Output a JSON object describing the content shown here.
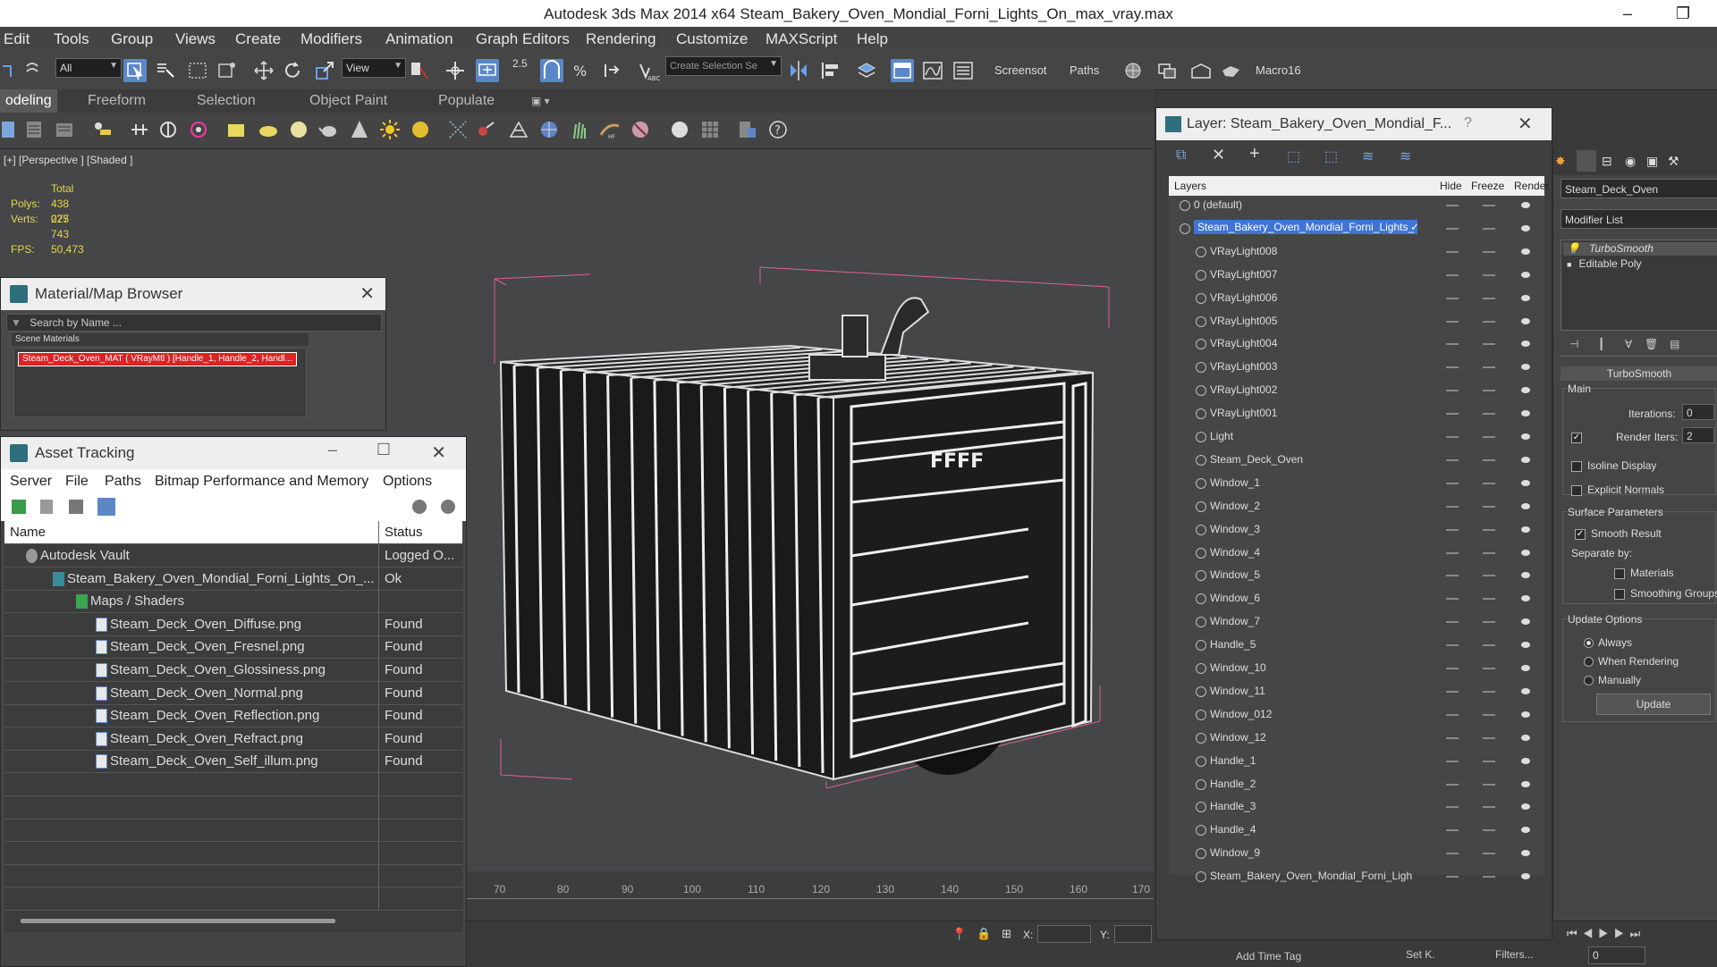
{
  "titlebar": {
    "text": "Autodesk 3ds Max  2014 x64     Steam_Bakery_Oven_Mondial_Forni_Lights_On_max_vray.max",
    "minimize": "–",
    "restore": "❐"
  },
  "menu": [
    "Edit",
    "Tools",
    "Group",
    "Views",
    "Create",
    "Modifiers",
    "Animation",
    "Graph Editors",
    "Rendering",
    "Customize",
    "MAXScript",
    "Help"
  ],
  "toolbar": {
    "filter_value": "All",
    "refcoord_value": "View",
    "snap_label": "2.5",
    "selection_set_placeholder": "Create Selection Se",
    "screenshot_label": "Screensot",
    "paths_label": "Paths",
    "macro_label": "Macro16"
  },
  "ribbon_tabs": [
    "odeling",
    "Freeform",
    "Selection",
    "Object Paint",
    "Populate"
  ],
  "viewport": {
    "label": "[+] [Perspective ] [Shaded ]",
    "stats": {
      "total_label": "Total",
      "polys_label": "Polys:",
      "polys_value": "438 075",
      "verts_label": "Verts:",
      "verts_value": "227 743",
      "fps_label": "FPS:",
      "fps_value": "50,473"
    }
  },
  "timeline": {
    "ticks": [
      "70",
      "80",
      "90",
      "100",
      "110",
      "120",
      "130",
      "140",
      "150",
      "160",
      "170"
    ]
  },
  "statusbar": {
    "x_label": "X:",
    "y_label": "Y:",
    "add_time_tag": "Add Time Tag",
    "setk": "Set K.",
    "filters": "Filters...",
    "frame_value": "0"
  },
  "material_browser": {
    "title": "Material/Map Browser",
    "search_placeholder": "Search by Name ...",
    "section": "Scene Materials",
    "item": "Steam_Deck_Oven_MAT ( VRayMtl ) [Handle_1, Handle_2, Handl..."
  },
  "asset_tracking": {
    "title": "Asset Tracking",
    "menu": [
      "Server",
      "File",
      "Paths",
      "Bitmap Performance and Memory",
      "Options"
    ],
    "col_name": "Name",
    "col_status": "Status",
    "rows": [
      {
        "name": "Autodesk Vault",
        "status": "Logged O...",
        "indent": 40,
        "icon": "vault-icon"
      },
      {
        "name": "Steam_Bakery_Oven_Mondial_Forni_Lights_On_...",
        "status": "Ok",
        "indent": 70,
        "icon": "max-file-icon"
      },
      {
        "name": "Maps / Shaders",
        "status": "",
        "indent": 96,
        "icon": "maps-folder-icon"
      },
      {
        "name": "Steam_Deck_Oven_Diffuse.png",
        "status": "Found",
        "indent": 118,
        "icon": "image-file-icon"
      },
      {
        "name": "Steam_Deck_Oven_Fresnel.png",
        "status": "Found",
        "indent": 118,
        "icon": "image-file-icon"
      },
      {
        "name": "Steam_Deck_Oven_Glossiness.png",
        "status": "Found",
        "indent": 118,
        "icon": "image-file-icon"
      },
      {
        "name": "Steam_Deck_Oven_Normal.png",
        "status": "Found",
        "indent": 118,
        "icon": "image-file-icon"
      },
      {
        "name": "Steam_Deck_Oven_Reflection.png",
        "status": "Found",
        "indent": 118,
        "icon": "image-file-icon"
      },
      {
        "name": "Steam_Deck_Oven_Refract.png",
        "status": "Found",
        "indent": 118,
        "icon": "image-file-icon"
      },
      {
        "name": "Steam_Deck_Oven_Self_illum.png",
        "status": "Found",
        "indent": 118,
        "icon": "image-file-icon"
      }
    ]
  },
  "layer_dialog": {
    "title": "Layer: Steam_Bakery_Oven_Mondial_F...",
    "help": "?",
    "col_layers": "Layers",
    "col_hide": "Hide",
    "col_freeze": "Freeze",
    "col_render": "Render",
    "rows": [
      {
        "name": "0 (default)",
        "level": 0,
        "selected": false
      },
      {
        "name": "Steam_Bakery_Oven_Mondial_Forni_Lights_",
        "level": 0,
        "selected": true
      },
      {
        "name": "VRayLight008",
        "level": 1,
        "selected": false
      },
      {
        "name": "VRayLight007",
        "level": 1,
        "selected": false
      },
      {
        "name": "VRayLight006",
        "level": 1,
        "selected": false
      },
      {
        "name": "VRayLight005",
        "level": 1,
        "selected": false
      },
      {
        "name": "VRayLight004",
        "level": 1,
        "selected": false
      },
      {
        "name": "VRayLight003",
        "level": 1,
        "selected": false
      },
      {
        "name": "VRayLight002",
        "level": 1,
        "selected": false
      },
      {
        "name": "VRayLight001",
        "level": 1,
        "selected": false
      },
      {
        "name": "Light",
        "level": 1,
        "selected": false
      },
      {
        "name": "Steam_Deck_Oven",
        "level": 1,
        "selected": false
      },
      {
        "name": "Window_1",
        "level": 1,
        "selected": false
      },
      {
        "name": "Window_2",
        "level": 1,
        "selected": false
      },
      {
        "name": "Window_3",
        "level": 1,
        "selected": false
      },
      {
        "name": "Window_4",
        "level": 1,
        "selected": false
      },
      {
        "name": "Window_5",
        "level": 1,
        "selected": false
      },
      {
        "name": "Window_6",
        "level": 1,
        "selected": false
      },
      {
        "name": "Window_7",
        "level": 1,
        "selected": false
      },
      {
        "name": "Handle_5",
        "level": 1,
        "selected": false
      },
      {
        "name": "Window_10",
        "level": 1,
        "selected": false
      },
      {
        "name": "Window_11",
        "level": 1,
        "selected": false
      },
      {
        "name": "Window_012",
        "level": 1,
        "selected": false
      },
      {
        "name": "Window_12",
        "level": 1,
        "selected": false
      },
      {
        "name": "Handle_1",
        "level": 1,
        "selected": false
      },
      {
        "name": "Handle_2",
        "level": 1,
        "selected": false
      },
      {
        "name": "Handle_3",
        "level": 1,
        "selected": false
      },
      {
        "name": "Handle_4",
        "level": 1,
        "selected": false
      },
      {
        "name": "Window_9",
        "level": 1,
        "selected": false
      },
      {
        "name": "Steam_Bakery_Oven_Mondial_Forni_Ligh",
        "level": 1,
        "selected": false
      }
    ]
  },
  "command_panel": {
    "object_name": "Steam_Deck_Oven",
    "modifier_list": "Modifier List",
    "stack": [
      "TurboSmooth",
      "Editable Poly"
    ],
    "rollout_title": "TurboSmooth",
    "main_label": "Main",
    "iterations_label": "Iterations:",
    "iterations_value": "0",
    "render_iters_label": "Render Iters:",
    "render_iters_value": "2",
    "isoline_label": "Isoline Display",
    "explicit_normals_label": "Explicit Normals",
    "surface_params_label": "Surface Parameters",
    "smooth_result_label": "Smooth Result",
    "separate_by_label": "Separate by:",
    "materials_label": "Materials",
    "smoothing_groups_label": "Smoothing Groups",
    "update_options_label": "Update Options",
    "always_label": "Always",
    "when_rendering_label": "When Rendering",
    "manually_label": "Manually",
    "update_button": "Update"
  }
}
